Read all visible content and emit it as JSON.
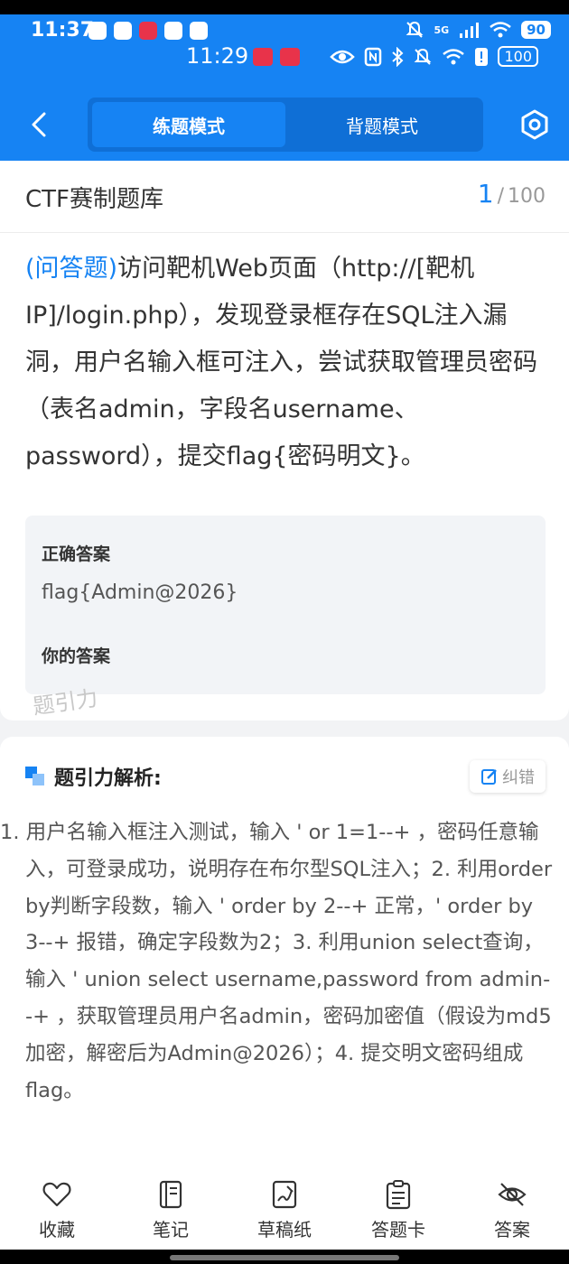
{
  "status_bar": {
    "time_primary": "11:37",
    "time_secondary": "11:29",
    "signal": "5G",
    "battery_primary": "90",
    "battery_secondary": "100"
  },
  "nav": {
    "tabs": [
      {
        "label": "练题模式",
        "active": true
      },
      {
        "label": "背题模式",
        "active": false
      }
    ]
  },
  "bank": {
    "title": "CTF赛制题库",
    "current": "1",
    "separator": "/",
    "total": "100"
  },
  "question": {
    "type": "(问答题)",
    "text": "访问靶机Web页面（http://[靶机IP]/login.php），发现登录框存在SQL注入漏洞，用户名输入框可注入，尝试获取管理员密码（表名admin，字段名username、password），提交flag{密码明文}。"
  },
  "answers": {
    "correct_label": "正确答案",
    "correct_value": "flag{Admin@2026}",
    "yours_label": "你的答案"
  },
  "watermark": "题引力",
  "analysis": {
    "title": "题引力解析:",
    "correct_button": "纠错",
    "text": "1. 用户名输入框注入测试，输入 ' or 1=1--+ ，密码任意输入，可登录成功，说明存在布尔型SQL注入；2. 利用order by判断字段数，输入 ' order by 2--+ 正常，' order by 3--+ 报错，确定字段数为2；3. 利用union select查询，输入 ' union select username,password from admin--+ ，获取管理员用户名admin，密码加密值（假设为md5加密，解密后为Admin@2026）；4. 提交明文密码组成flag。"
  },
  "toolbar": {
    "items": [
      {
        "label": "收藏",
        "icon": "heart-icon"
      },
      {
        "label": "笔记",
        "icon": "notebook-icon"
      },
      {
        "label": "草稿纸",
        "icon": "draft-icon"
      },
      {
        "label": "答题卡",
        "icon": "answer-card-icon"
      },
      {
        "label": "答案",
        "icon": "eye-off-icon"
      }
    ]
  },
  "colors": {
    "accent": "#1683f3",
    "accent_dark": "#0f6fd6",
    "background": "#f2f3f5"
  }
}
